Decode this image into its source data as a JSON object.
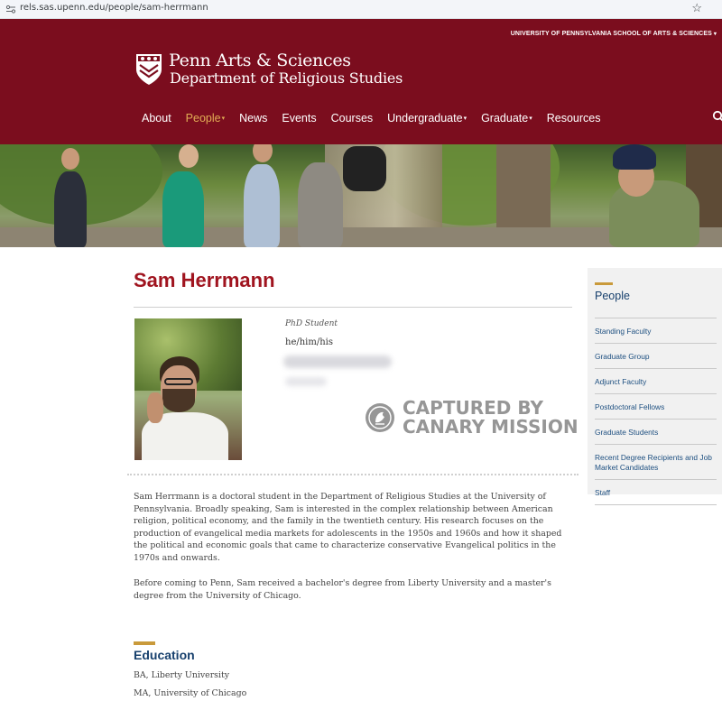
{
  "browser": {
    "url": "rels.sas.upenn.edu/people/sam-herrmann"
  },
  "header": {
    "top_link": "UNIVERSITY OF PENNSYLVANIA SCHOOL OF ARTS & SCIENCES",
    "logo_line1": "Penn Arts & Sciences",
    "logo_line2": "Department of Religious Studies",
    "nav": [
      {
        "label": "About",
        "dropdown": false
      },
      {
        "label": "People",
        "dropdown": true,
        "active": true
      },
      {
        "label": "News",
        "dropdown": false
      },
      {
        "label": "Events",
        "dropdown": false
      },
      {
        "label": "Courses",
        "dropdown": false
      },
      {
        "label": "Undergraduate",
        "dropdown": true
      },
      {
        "label": "Graduate",
        "dropdown": true
      },
      {
        "label": "Resources",
        "dropdown": false
      }
    ],
    "dropdown_caret": "▾",
    "accent_color": "#e2ad55",
    "brand_color": "#7b0d1e"
  },
  "profile": {
    "name": "Sam Herrmann",
    "role": "PhD Student",
    "pronouns": "he/him/his",
    "bio_paragraph1": "Sam Herrmann is a doctoral student in the Department of Religious Studies at the University of Pennsylvania. Broadly speaking, Sam is interested in the complex relationship between American religion, political economy, and the family in the twentieth century. His research focuses on the production of evangelical media markets for adolescents in the 1950s and 1960s and how it shaped the political and economic goals that came to characterize conservative Evangelical politics in the 1970s and onwards.",
    "bio_paragraph2": "Before coming to Penn, Sam received a bachelor's degree from Liberty University and a master's degree from the University of Chicago.",
    "education_heading": "Education",
    "education": [
      "BA, Liberty University",
      "MA, University of Chicago"
    ]
  },
  "watermark": {
    "line1": "CAPTURED BY",
    "line2": "CANARY MISSION"
  },
  "sidebar": {
    "title": "People",
    "items": [
      "Standing Faculty",
      "Graduate Group",
      "Adjunct Faculty",
      "Postdoctoral Fellows",
      "Graduate Students",
      "Recent Degree Recipients and Job Market Candidates",
      "Staff"
    ]
  },
  "icons": {
    "site_icon": "site-settings-icon",
    "bookmark": "star-icon",
    "search": "search-icon",
    "logo": "penn-shield-icon",
    "watermark": "canary-icon"
  }
}
